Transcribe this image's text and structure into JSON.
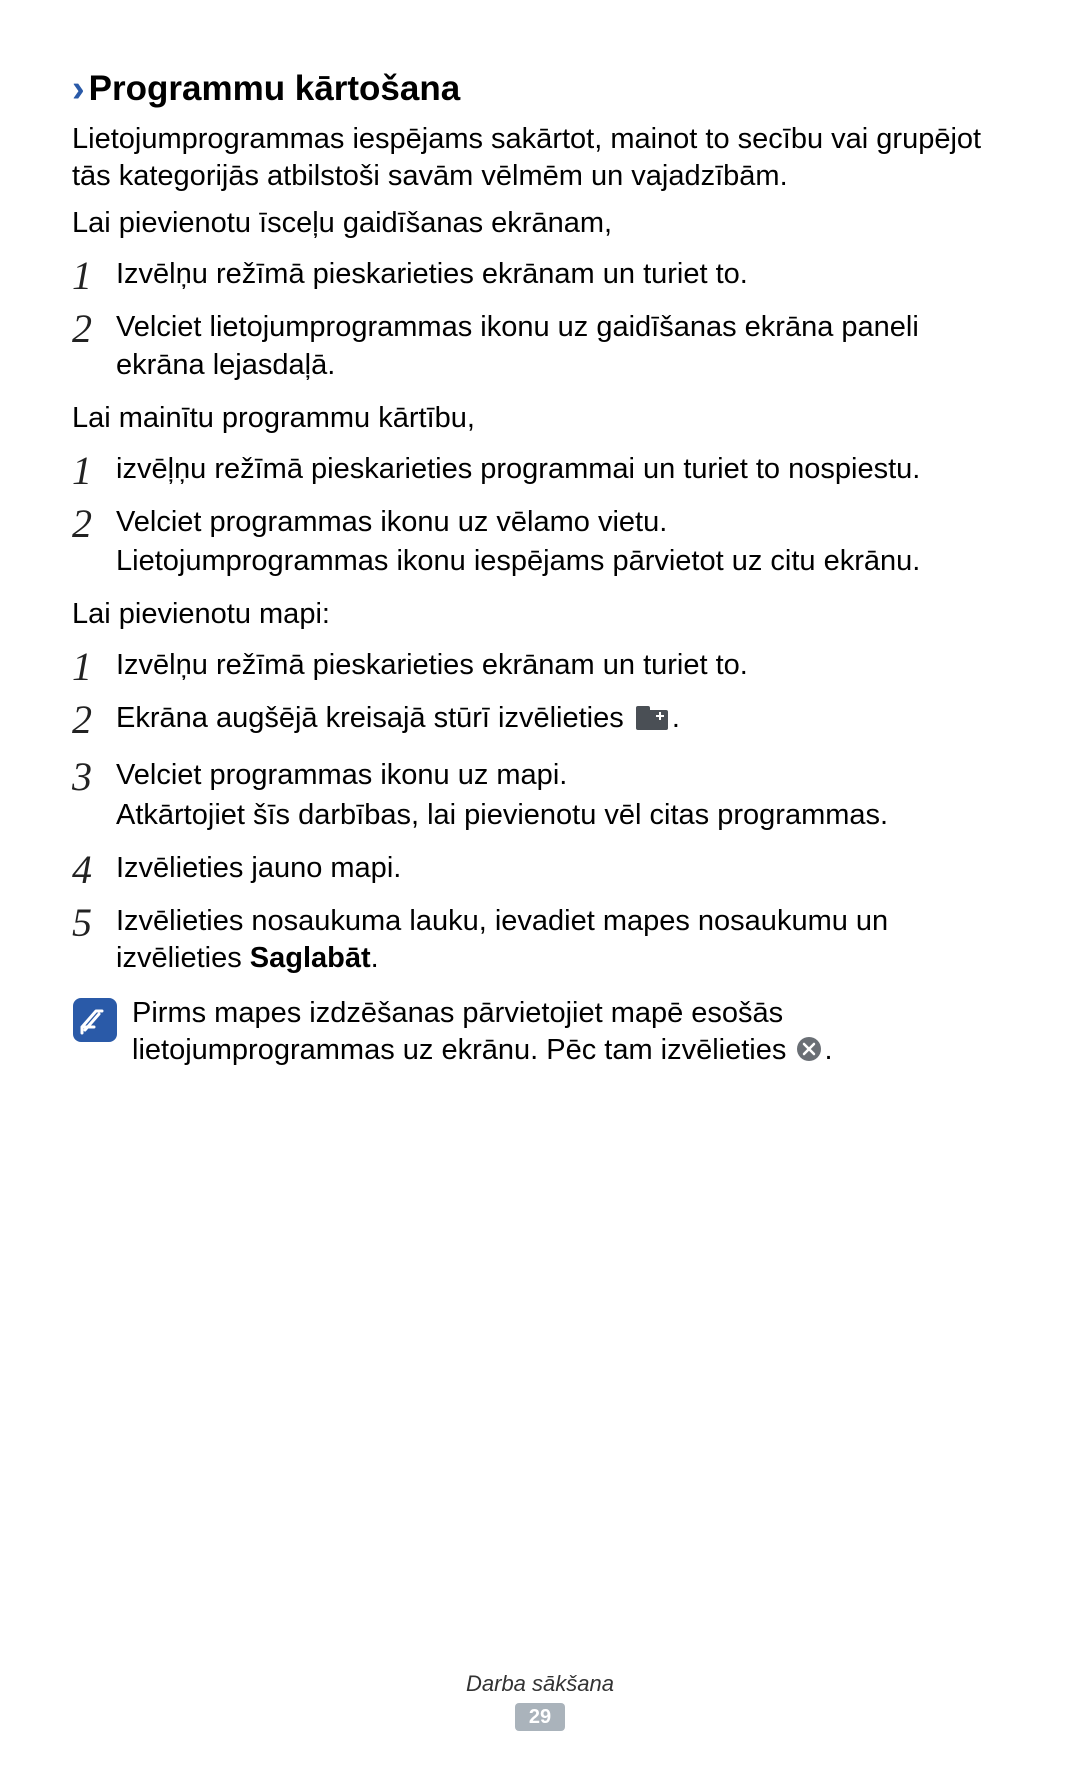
{
  "heading": "Programmu kārtošana",
  "intro_para": "Lietojumprogrammas iespējams sakārtot, mainot to secību vai grupējot tās kategorijās atbilstoši savām vēlmēm un vajadzībām.",
  "add_shortcut_leadin": "Lai pievienotu īsceļu gaidīšanas ekrānam,",
  "shortcut_steps": [
    "Izvēlņu režīmā pieskarieties ekrānam un turiet to.",
    "Velciet lietojumprogrammas ikonu uz gaidīšanas ekrāna paneli ekrāna lejasdaļā."
  ],
  "change_order_leadin": "Lai mainītu programmu kārtību,",
  "order_steps": [
    {
      "main": "izvēļņu režīmā pieskarieties programmai un turiet to nospiestu."
    },
    {
      "main": "Velciet programmas ikonu uz vēlamo vietu.",
      "sub": "Lietojumprogrammas ikonu iespējams pārvietot uz citu ekrānu."
    }
  ],
  "add_folder_leadin": "Lai pievienotu mapi:",
  "folder_steps": {
    "s1": "Izvēlņu režīmā pieskarieties ekrānam un turiet to.",
    "s2_prefix": "Ekrāna augšējā kreisajā stūrī izvēlieties ",
    "s2_suffix": ".",
    "s3_main": "Velciet programmas ikonu uz mapi.",
    "s3_sub": "Atkārtojiet šīs darbības, lai pievienotu vēl citas programmas.",
    "s4": "Izvēlieties jauno mapi.",
    "s5_prefix": "Izvēlieties nosaukuma lauku, ievadiet mapes nosaukumu un izvēlieties ",
    "s5_bold": "Saglabāt",
    "s5_suffix": "."
  },
  "note_prefix": "Pirms mapes izdzēšanas pārvietojiet mapē esošās lietojumprogrammas uz ekrānu. Pēc tam izvēlieties ",
  "note_suffix": ".",
  "footer_label": "Darba sākšana",
  "page_number": "29"
}
